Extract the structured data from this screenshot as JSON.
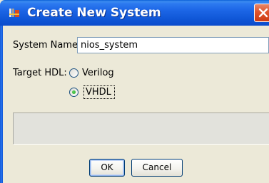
{
  "window": {
    "title": "Create New System",
    "app_icon": "qsys-app-icon",
    "close_icon": "close-icon"
  },
  "form": {
    "system_name_label": "System Name:",
    "system_name_value": "nios_system",
    "target_hdl_label": "Target HDL:",
    "hdl_options": [
      {
        "label": "Verilog",
        "selected": false
      },
      {
        "label": "VHDL",
        "selected": true
      }
    ]
  },
  "buttons": {
    "ok_label": "OK",
    "cancel_label": "Cancel"
  }
}
